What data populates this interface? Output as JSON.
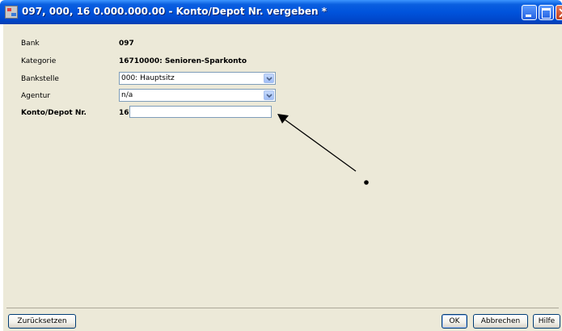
{
  "window": {
    "title": "097, 000, 16 0.000.000.00 - Konto/Depot Nr. vergeben *"
  },
  "form": {
    "bank": {
      "label": "Bank",
      "value": "097"
    },
    "kategorie": {
      "label": "Kategorie",
      "value": "16710000: Senioren-Sparkonto"
    },
    "bankstelle": {
      "label": "Bankstelle",
      "value": "000: Hauptsitz"
    },
    "agentur": {
      "label": "Agentur",
      "value": "n/a"
    },
    "konto": {
      "label": "Konto/Depot Nr.",
      "prefix": "16",
      "value": ""
    }
  },
  "buttons": {
    "reset": "Zurücksetzen",
    "ok": "OK",
    "cancel": "Abbrechen",
    "help": "Hilfe"
  },
  "colors": {
    "titlebar": "#0053dc",
    "client_background": "#ece9d8",
    "input_border": "#7f9db9"
  }
}
